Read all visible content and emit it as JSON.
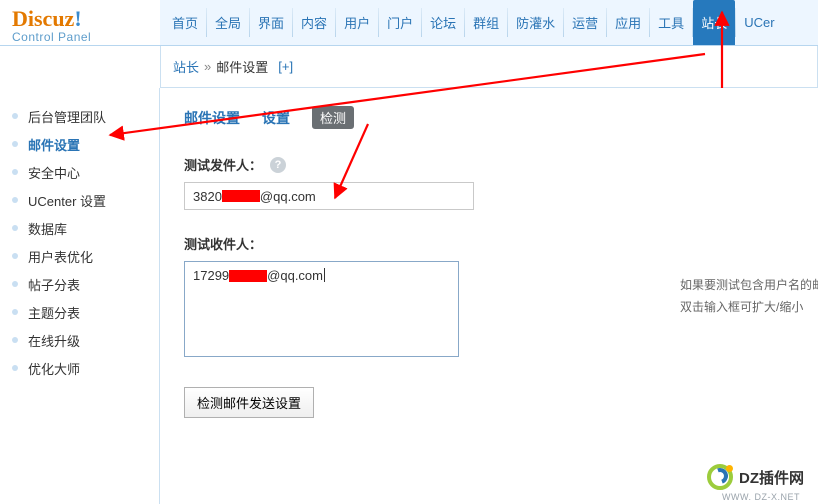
{
  "logo": {
    "brand_a": "Discuz",
    "brand_bang": "!",
    "sub": "Control Panel"
  },
  "nav": {
    "items": [
      "首页",
      "全局",
      "界面",
      "内容",
      "用户",
      "门户",
      "论坛",
      "群组",
      "防灌水",
      "运营",
      "应用",
      "工具",
      "站长",
      "UCer"
    ],
    "active_index": 12
  },
  "breadcrumb": {
    "root": "站长",
    "sep": "»",
    "page": "邮件设置",
    "plus": "[+]"
  },
  "sidebar": {
    "items": [
      "后台管理团队",
      "邮件设置",
      "安全中心",
      "UCenter 设置",
      "数据库",
      "用户表优化",
      "帖子分表",
      "主题分表",
      "在线升级",
      "优化大师"
    ],
    "active_index": 1
  },
  "tabs": {
    "t1": "邮件设置",
    "t2": "设置",
    "detect": "检测"
  },
  "form": {
    "sender_label": "测试发件人：",
    "sender_prefix": "3820",
    "sender_suffix": "@qq.com",
    "receiver_label": "测试收件人：",
    "receiver_prefix": "17299",
    "receiver_suffix": "@qq.com",
    "hint_line1": "如果要测试包含用户名的邮件地址，格式为",
    "hint_line2": "双击输入框可扩大/缩小",
    "submit": "检测邮件发送设置"
  },
  "watermark": {
    "text": "DZ插件网",
    "url": "WWW. DZ-X.NET"
  }
}
